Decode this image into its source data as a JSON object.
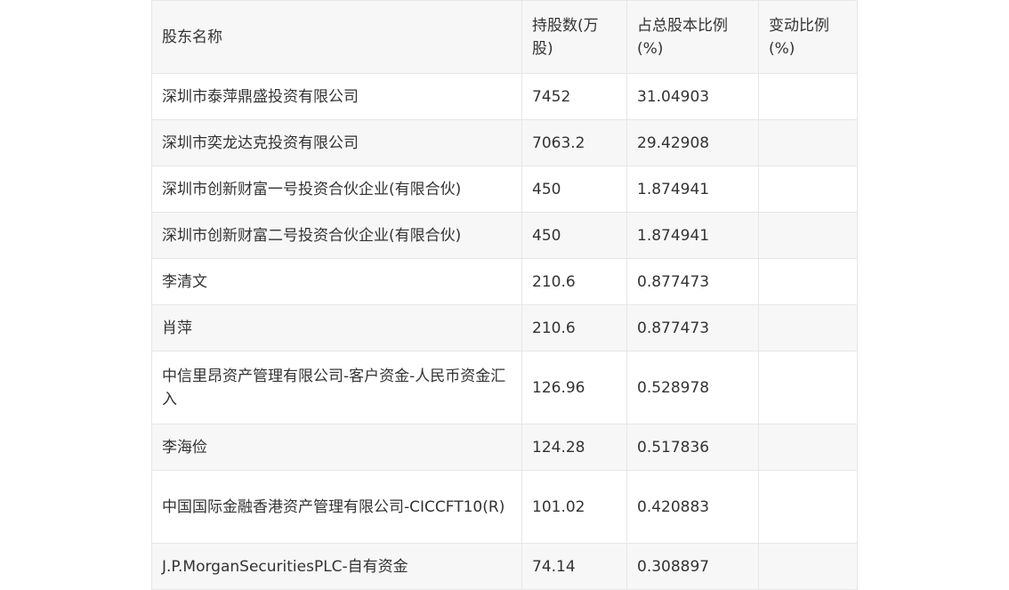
{
  "table": {
    "headers": [
      "股东名称",
      "持股数(万股)",
      "占总股本比例(%)",
      "变动比例(%)"
    ],
    "rows": [
      {
        "name": "深圳市泰萍鼎盛投资有限公司",
        "shares": "7452",
        "ratio": "31.04903",
        "change": ""
      },
      {
        "name": "深圳市奕龙达克投资有限公司",
        "shares": "7063.2",
        "ratio": "29.42908",
        "change": ""
      },
      {
        "name": "深圳市创新财富一号投资合伙企业(有限合伙)",
        "shares": "450",
        "ratio": "1.874941",
        "change": ""
      },
      {
        "name": "深圳市创新财富二号投资合伙企业(有限合伙)",
        "shares": "450",
        "ratio": "1.874941",
        "change": ""
      },
      {
        "name": "李清文",
        "shares": "210.6",
        "ratio": "0.877473",
        "change": ""
      },
      {
        "name": "肖萍",
        "shares": "210.6",
        "ratio": "0.877473",
        "change": ""
      },
      {
        "name": "中信里昂资产管理有限公司-客户资金-人民币资金汇入",
        "shares": "126.96",
        "ratio": "0.528978",
        "change": ""
      },
      {
        "name": "李海俭",
        "shares": "124.28",
        "ratio": "0.517836",
        "change": ""
      },
      {
        "name": "中国国际金融香港资产管理有限公司-CICCFT10(R)",
        "shares": "101.02",
        "ratio": "0.420883",
        "change": ""
      },
      {
        "name": "J.P.MorganSecuritiesPLC-自有资金",
        "shares": "74.14",
        "ratio": "0.308897",
        "change": ""
      }
    ]
  }
}
